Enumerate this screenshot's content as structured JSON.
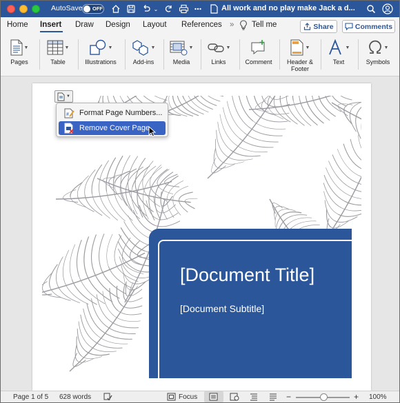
{
  "titlebar": {
    "autosave_label": "AutoSave",
    "autosave_state": "OFF",
    "document_title": "All work and no play make Jack a d...",
    "icons": [
      "home-icon",
      "save-icon",
      "undo-icon",
      "redo-icon",
      "print-icon",
      "document-icon",
      "more-icon",
      "search-icon",
      "account-icon"
    ]
  },
  "tabs": {
    "items": [
      "Home",
      "Insert",
      "Draw",
      "Design",
      "Layout",
      "References",
      "Tell me"
    ],
    "active": "Insert",
    "share_label": "Share",
    "comments_label": "Comments"
  },
  "ribbon": {
    "groups": [
      {
        "label": "Pages",
        "icon": "pages-icon"
      },
      {
        "label": "Table",
        "icon": "table-icon"
      },
      {
        "label": "Illustrations",
        "icon": "illustrations-icon"
      },
      {
        "label": "Add-ins",
        "icon": "add-ins-icon"
      },
      {
        "label": "Media",
        "icon": "media-icon"
      },
      {
        "label": "Links",
        "icon": "links-icon"
      },
      {
        "label": "Comment",
        "icon": "comment-icon"
      },
      {
        "label": "Header &",
        "label2": "Footer",
        "icon": "header-footer-icon"
      },
      {
        "label": "Text",
        "icon": "text-icon"
      },
      {
        "label": "Symbols",
        "icon": "symbols-icon"
      }
    ]
  },
  "document": {
    "title_placeholder": "[Document Title]",
    "subtitle_placeholder": "[Document Subtitle]",
    "cover_color": "#2b579a"
  },
  "page_number_menu": {
    "items": [
      {
        "label": "Format Page Numbers...",
        "icon": "format-page-numbers-icon",
        "highlighted": false
      },
      {
        "label": "Remove Cover Page",
        "icon": "remove-cover-page-icon",
        "highlighted": true
      }
    ]
  },
  "statusbar": {
    "page": "Page 1 of 5",
    "words": "628 words",
    "focus_label": "Focus",
    "zoom": "100%"
  },
  "colors": {
    "accent": "#2b579a",
    "menu_highlight": "#3a64c4"
  }
}
